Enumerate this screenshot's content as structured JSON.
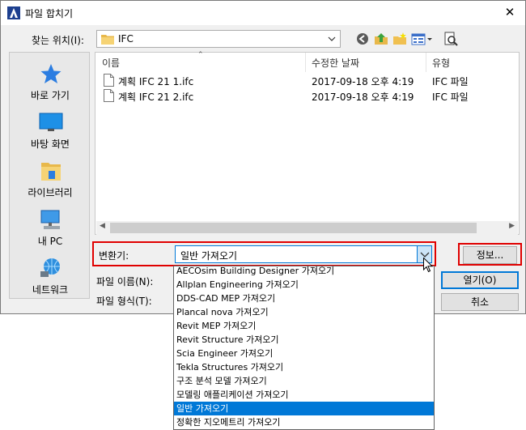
{
  "window": {
    "title": "파일 합치기"
  },
  "lookin": {
    "label": "찾는 위치(I):",
    "value": "IFC"
  },
  "places": [
    {
      "label": "바로 가기",
      "icon": "star-icon"
    },
    {
      "label": "바탕 화면",
      "icon": "desktop-icon"
    },
    {
      "label": "라이브러리",
      "icon": "library-icon"
    },
    {
      "label": "내 PC",
      "icon": "computer-icon"
    },
    {
      "label": "네트워크",
      "icon": "network-icon"
    }
  ],
  "filelist": {
    "columns": [
      "이름",
      "수정한 날짜",
      "유형"
    ],
    "rows": [
      {
        "name": "계획 IFC 21 1.ifc",
        "date": "2017-09-18 오후 4:19",
        "type": "IFC 파일"
      },
      {
        "name": "계획 IFC 21 2.ifc",
        "date": "2017-09-18 오후 4:19",
        "type": "IFC 파일"
      }
    ]
  },
  "converter": {
    "label": "변환기:",
    "selected": "일반 가져오기",
    "options": [
      "AECOsim Building Designer 가져오기",
      "Allplan Engineering 가져오기",
      "DDS-CAD MEP 가져오기",
      "Plancal nova 가져오기",
      "Revit MEP 가져오기",
      "Revit Structure 가져오기",
      "Scia Engineer 가져오기",
      "Tekla Structures 가져오기",
      "구조 분석 모델 가져오기",
      "모델링 애플리케이션 가져오기",
      "일반 가져오기",
      "정확한 지오메트리 가져오기"
    ],
    "selected_index": 10
  },
  "buttons": {
    "info": "정보...",
    "open": "열기(O)",
    "cancel": "취소"
  },
  "fields": {
    "filename_label": "파일 이름(N):",
    "filetype_label": "파일 형식(T):"
  },
  "colors": {
    "accent": "#0078d7",
    "highlight_frame": "#e00000"
  }
}
